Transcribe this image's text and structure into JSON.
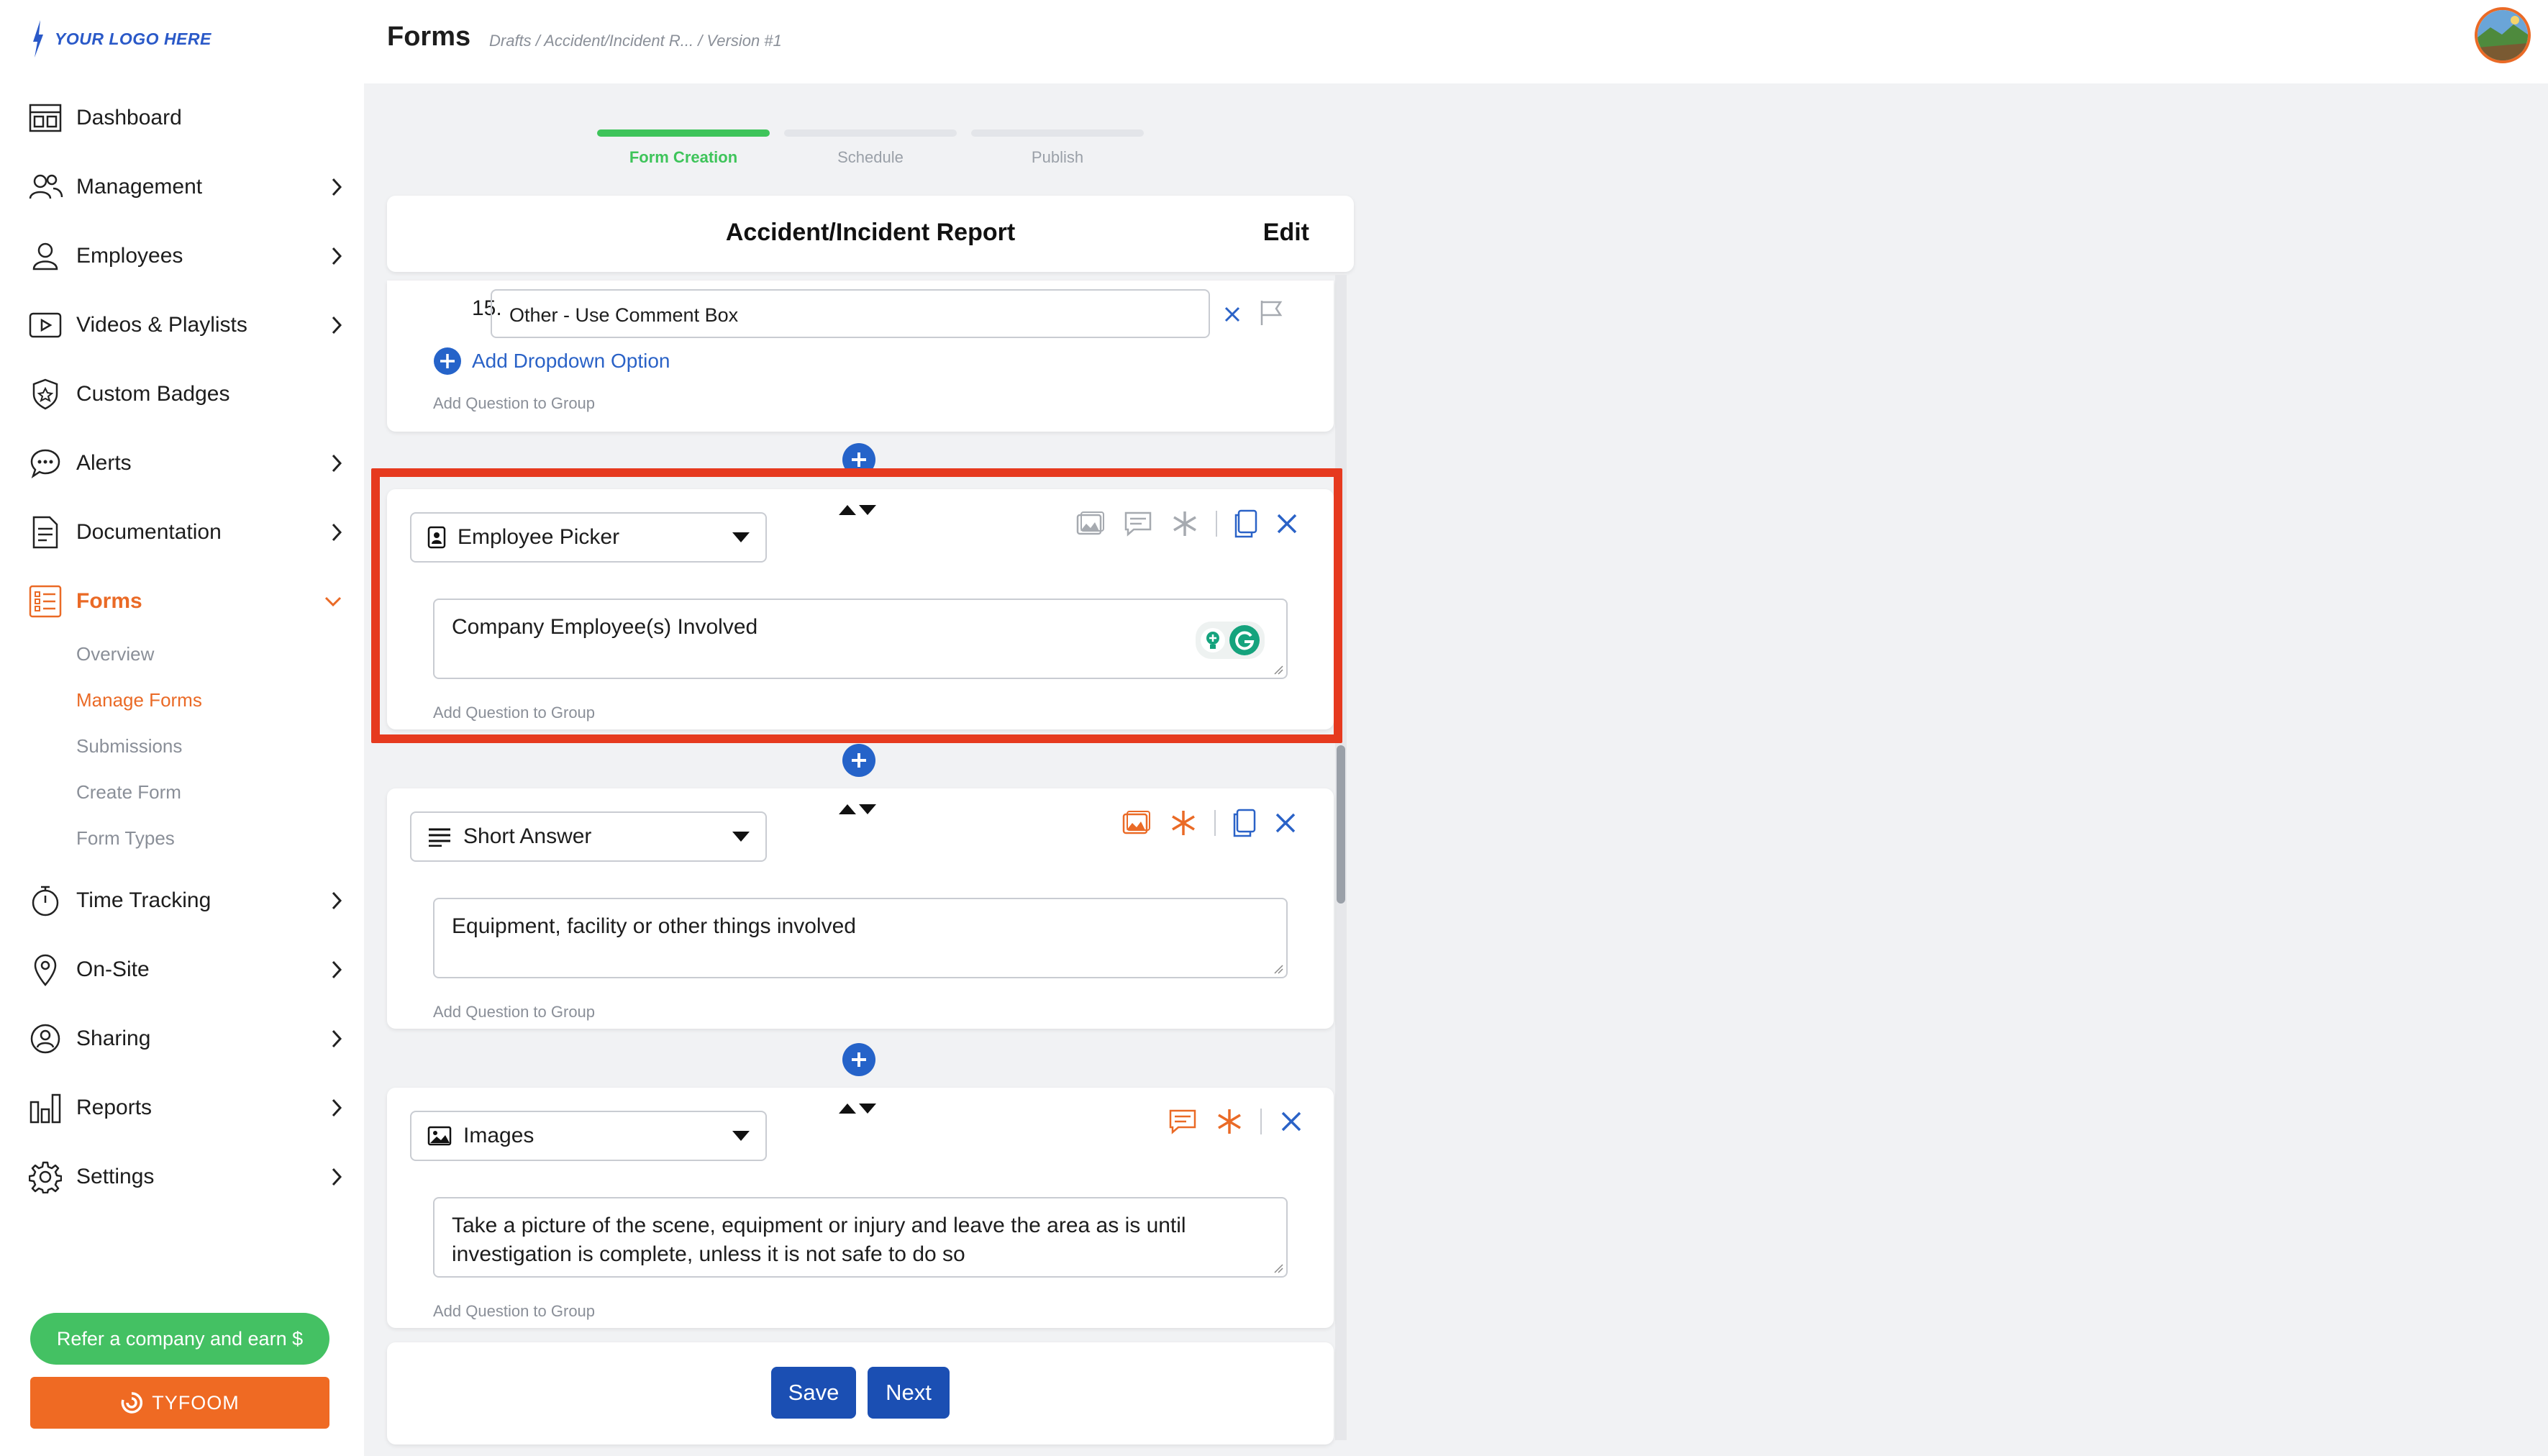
{
  "brand": {
    "logo_text": "YOUR LOGO HERE"
  },
  "sidebar": {
    "items": [
      {
        "label": "Dashboard",
        "icon": "dashboard-icon",
        "chevron": false
      },
      {
        "label": "Management",
        "icon": "people-icon",
        "chevron": true
      },
      {
        "label": "Employees",
        "icon": "person-icon",
        "chevron": true
      },
      {
        "label": "Videos & Playlists",
        "icon": "video-icon",
        "chevron": true
      },
      {
        "label": "Custom Badges",
        "icon": "badge-icon",
        "chevron": false
      },
      {
        "label": "Alerts",
        "icon": "chat-bubble-icon",
        "chevron": true
      },
      {
        "label": "Documentation",
        "icon": "document-icon",
        "chevron": true
      },
      {
        "label": "Forms",
        "icon": "forms-icon",
        "chevron": true,
        "active": true
      }
    ],
    "forms_sub": [
      {
        "label": "Overview"
      },
      {
        "label": "Manage Forms",
        "active": true
      },
      {
        "label": "Submissions"
      },
      {
        "label": "Create Form"
      },
      {
        "label": "Form Types"
      }
    ],
    "items_lower": [
      {
        "label": "Time Tracking",
        "icon": "stopwatch-icon"
      },
      {
        "label": "On-Site",
        "icon": "location-pin-icon"
      },
      {
        "label": "Sharing",
        "icon": "share-icon"
      },
      {
        "label": "Reports",
        "icon": "bar-chart-icon"
      },
      {
        "label": "Settings",
        "icon": "gear-icon"
      }
    ],
    "refer_label": "Refer a company and earn $",
    "tyfoom_label": "TYFOOM"
  },
  "header": {
    "title": "Forms",
    "breadcrumb": "Drafts  /  Accident/Incident R...  /  Version #1"
  },
  "steps": [
    {
      "label": "Form Creation",
      "done": true
    },
    {
      "label": "Schedule",
      "done": false
    },
    {
      "label": "Publish",
      "done": false
    }
  ],
  "form": {
    "title": "Accident/Incident Report",
    "edit_label": "Edit",
    "option_number": "15.",
    "option_value": "Other - Use Comment Box",
    "add_option_label": "Add Dropdown Option",
    "add_to_group_label": "Add Question to Group",
    "questions": [
      {
        "type": "Employee Picker",
        "type_icon": "employee-picker-icon",
        "text": "Company Employee(s) Involved"
      },
      {
        "type": "Short Answer",
        "type_icon": "short-answer-icon",
        "text": "Equipment, facility or other things involved"
      },
      {
        "type": "Images",
        "type_icon": "image-icon",
        "text": "Take a picture of the scene, equipment or injury and leave the area as is until investigation is complete, unless it is not safe to do so"
      }
    ]
  },
  "actions": {
    "save_label": "Save",
    "next_label": "Next"
  },
  "colors": {
    "accent_orange": "#ea6a26",
    "link_blue": "#2a62c7",
    "button_blue": "#1b4fb3",
    "progress_green": "#3ec45a",
    "highlight_red": "#e63a1f"
  }
}
